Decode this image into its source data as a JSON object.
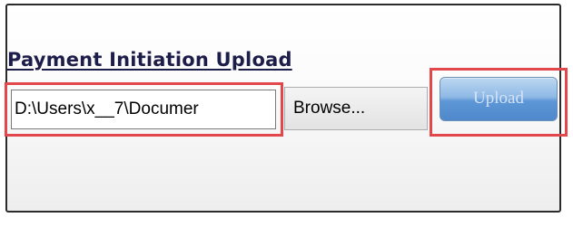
{
  "upload_panel": {
    "title": "Payment Initiation Upload",
    "file_input_value": "D:\\Users\\x__7\\Documer",
    "browse_label": "Browse...",
    "upload_label": "Upload",
    "highlight_color": "#e2474b",
    "upload_button_color": "#5d97d6"
  }
}
